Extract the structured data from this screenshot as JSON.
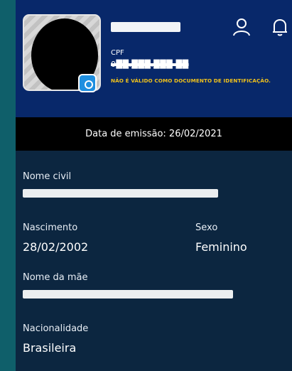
{
  "header": {
    "cpf_label": "CPF",
    "cpf_value": "0██.███.███-██",
    "notice": "NÃO É VÁLIDO COMO DOCUMENTO DE IDENTIFICAÇÃO.",
    "icons": [
      "user-icon",
      "bell-icon"
    ]
  },
  "emission": {
    "text": "Data de emissão: 26/02/2021"
  },
  "fields": {
    "nome_civil_label": "Nome civil",
    "nascimento_label": "Nascimento",
    "nascimento_value": "28/02/2002",
    "sexo_label": "Sexo",
    "sexo_value": "Feminino",
    "mae_label": "Nome da mãe",
    "nacionalidade_label": "Nacionalidade",
    "nacionalidade_value": "Brasileira"
  },
  "colors": {
    "header_bg": "#08286a",
    "body_bg": "#0c2640",
    "notice": "#f1c21b",
    "outer_bg": "#0f5f6a"
  }
}
